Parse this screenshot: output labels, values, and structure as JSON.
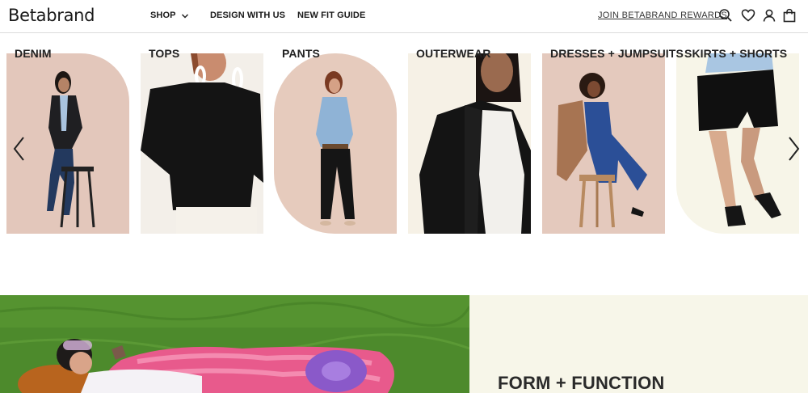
{
  "header": {
    "logo": "Betabrand",
    "nav": [
      {
        "label": "SHOP"
      },
      {
        "label": "DESIGN WITH US"
      },
      {
        "label": "NEW FIT GUIDE"
      }
    ],
    "rewards_link": "JOIN BETABRAND REWARDS",
    "icons": [
      "search-icon",
      "heart-icon",
      "account-icon",
      "bag-icon"
    ]
  },
  "categories": [
    {
      "label": "DENIM"
    },
    {
      "label": "TOPS"
    },
    {
      "label": "PANTS"
    },
    {
      "label": "OUTERWEAR"
    },
    {
      "label": "DRESSES + JUMPSUITS"
    },
    {
      "label": "SKIRTS + SHORTS"
    }
  ],
  "carousel_controls": {
    "prev_icon": "chevron-left-icon",
    "next_icon": "chevron-right-icon"
  },
  "hero": {
    "title": "FORM + FUNCTION"
  },
  "colors": {
    "text": "#222222",
    "hero_panel_bg": "#f7f6e9",
    "divider": "#dcdcdc"
  }
}
